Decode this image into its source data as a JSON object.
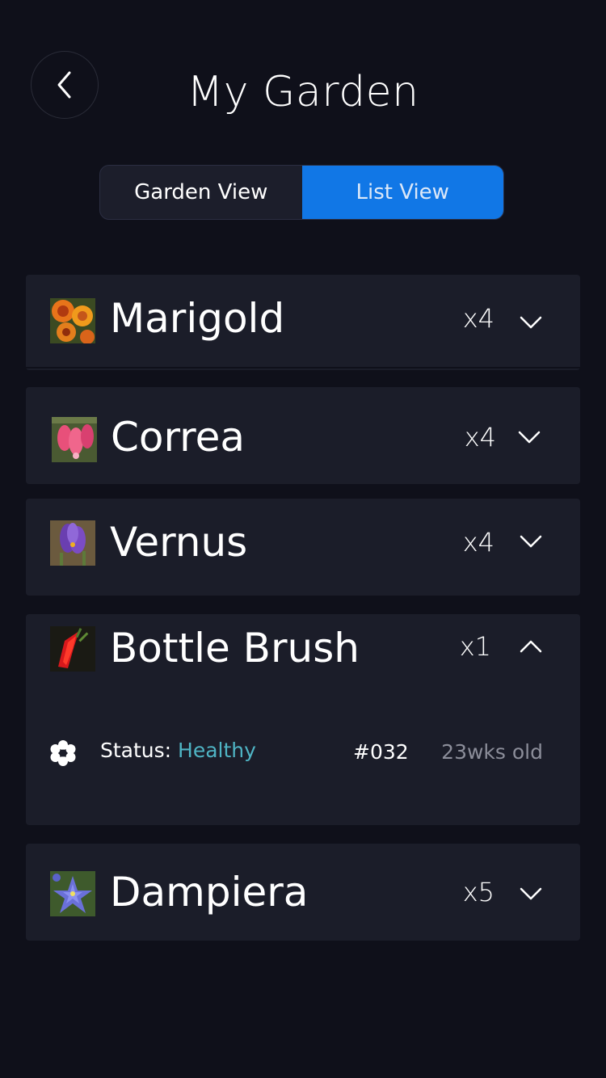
{
  "header": {
    "title": "My Garden",
    "back_icon": "chevron-left-icon"
  },
  "view_toggle": {
    "options": [
      "Garden View",
      "List View"
    ],
    "selected": "List View"
  },
  "plants": [
    {
      "name": "Marigold",
      "count": "x4",
      "expanded": false,
      "thumb": "marigold-image"
    },
    {
      "name": "Correa",
      "count": "x4",
      "expanded": false,
      "thumb": "correa-image"
    },
    {
      "name": "Vernus",
      "count": "x4",
      "expanded": false,
      "thumb": "vernus-image"
    },
    {
      "name": "Bottle Brush",
      "count": "x1",
      "expanded": true,
      "thumb": "bottle-brush-image",
      "detail": {
        "status_label": "Status:",
        "status_value": "Healthy",
        "id": "#032",
        "age": "23wks old",
        "icon": "flower-icon"
      }
    },
    {
      "name": "Dampiera",
      "count": "x5",
      "expanded": false,
      "thumb": "dampiera-image"
    }
  ],
  "colors": {
    "background": "#0f101a",
    "card": "#1b1d29",
    "accent": "#1177e6",
    "status_healthy": "#4fb4c4",
    "muted_text": "#8c8e9a"
  }
}
